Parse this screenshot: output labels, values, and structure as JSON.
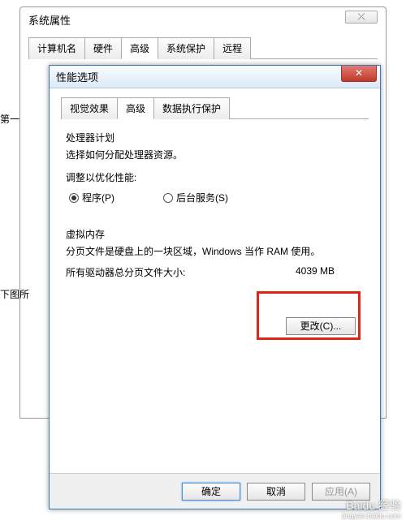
{
  "bg_dialog": {
    "title": "系统属性",
    "close_glyph": "⤫",
    "tabs": [
      "计算机名",
      "硬件",
      "高级",
      "系统保护",
      "远程"
    ],
    "active_tab_index": 2
  },
  "side_labels": {
    "label1": "第一",
    "label2": "下图所"
  },
  "front_dialog": {
    "title": "性能选项",
    "close_glyph": "✕",
    "tabs": [
      "视觉效果",
      "高级",
      "数据执行保护"
    ],
    "active_tab_index": 1
  },
  "processor": {
    "heading": "处理器计划",
    "desc": "选择如何分配处理器资源。",
    "adjust_label": "调整以优化性能:",
    "opt_program": "程序(P)",
    "opt_service": "后台服务(S)"
  },
  "vm": {
    "heading": "虚拟内存",
    "desc": "分页文件是硬盘上的一块区域，Windows 当作 RAM 使用。",
    "total_label": "所有驱动器总分页文件大小:",
    "total_value": "4039 MB",
    "change_btn": "更改(C)..."
  },
  "footer": {
    "ok": "确定",
    "cancel": "取消",
    "apply": "应用(A)"
  },
  "watermark": {
    "main": "Baidu 经验",
    "sub": "jingyan.baidu.com"
  }
}
